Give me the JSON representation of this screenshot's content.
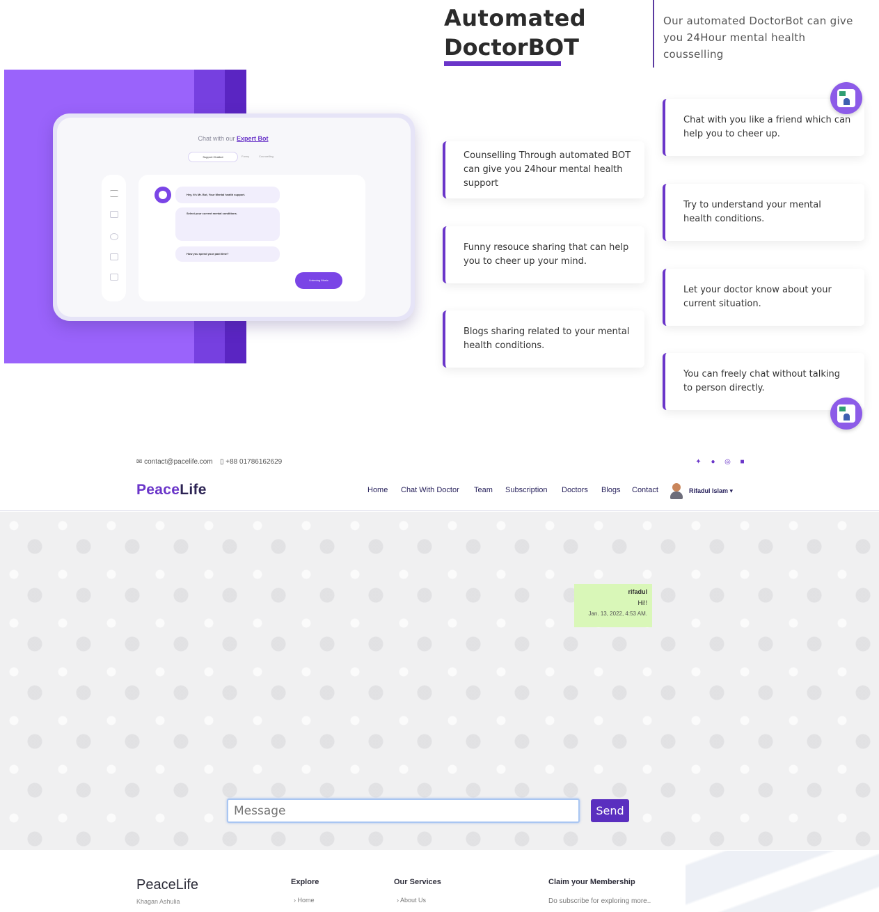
{
  "feature": {
    "title_line1": "Automated",
    "title_line2": "DoctorBOT",
    "description": "Our automated DoctorBot can give you 24Hour mental health cousselling",
    "device": {
      "title_prefix": "Chat with our ",
      "title_highlight": "Expert Bot",
      "tab_active": "Support Chatbot",
      "tab_2": "Funny",
      "tab_3": "Counselling",
      "bubble_1": "Hey, It's Mr. Bot, Your Mental health support.",
      "bubble_2": "Select your current mental conditions.",
      "bubble_3": "How you spend your past time?",
      "button": "Listening Music"
    },
    "cards_left": [
      "Counselling Through automated BOT can give you 24hour mental health support",
      "Funny resouce sharing that can help you to cheer up your mind.",
      "Blogs sharing related to your mental health conditions."
    ],
    "cards_right": [
      "Chat with you like a friend which can help you to cheer up.",
      "Try to understand your mental health conditions.",
      "Let your doctor know about your current situation.",
      "You can freely chat without talking to person directly."
    ],
    "accent_color": "#6a35c9",
    "bg_purple": "#9a63fb"
  },
  "topbar": {
    "email": "contact@pacelife.com",
    "phone": "+88 01786162629",
    "social_icons": [
      "twitter-icon",
      "facebook-icon",
      "instagram-icon",
      "linkedin-icon"
    ]
  },
  "nav": {
    "logo_part1": "Peace",
    "logo_part2": "Life",
    "links": [
      "Home",
      "Chat With Doctor",
      "Team",
      "Subscription",
      "Doctors",
      "Blogs",
      "Contact"
    ],
    "user_name": "Rifadul Islam ▾"
  },
  "chat": {
    "messages": [
      {
        "user": "rifadul",
        "text": "Hi!!",
        "time": "Jan. 13, 2022, 4:53 AM."
      }
    ],
    "input_placeholder": "Message",
    "send_label": "Send",
    "bubble_color": "#d9f7b8"
  },
  "footer": {
    "brand": "PeaceLife",
    "brand_sub": "Khagan Ashulia",
    "explore_title": "Explore",
    "explore_first": "Home",
    "services_title": "Our Services",
    "services_first": "About Us",
    "membership_title": "Claim your Membership",
    "membership_text": "Do subscribe for exploring more.."
  }
}
